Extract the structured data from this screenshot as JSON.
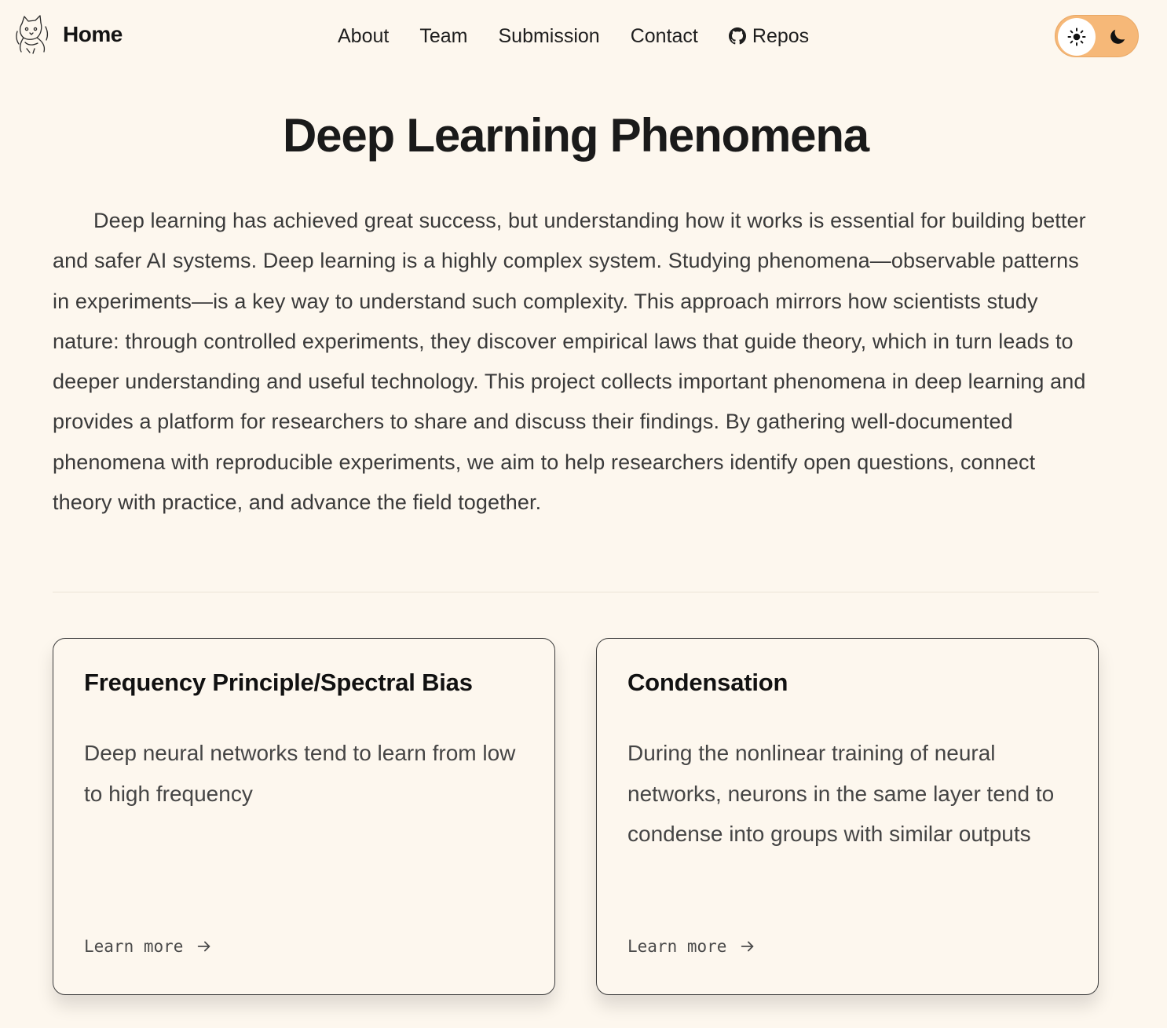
{
  "header": {
    "home_label": "Home",
    "logo_icon": "cat-sketch-logo-icon",
    "nav": [
      {
        "label": "About"
      },
      {
        "label": "Team"
      },
      {
        "label": "Submission"
      },
      {
        "label": "Contact"
      },
      {
        "label": "Repos",
        "icon": "github-icon"
      }
    ],
    "theme_toggle": {
      "light_icon": "sun-icon",
      "dark_icon": "moon-icon",
      "selected": "light",
      "accent_color": "#f6b878"
    }
  },
  "main": {
    "title": "Deep Learning Phenomena",
    "intro": "Deep learning has achieved great success, but understanding how it works is essential for building better and safer AI systems. Deep learning is a highly complex system. Studying phenomena—observable patterns in experiments—is a key way to understand such complexity. This approach mirrors how scientists study nature: through controlled experiments, they discover empirical laws that guide theory, which in turn leads to deeper understanding and useful technology. This project collects important phenomena in deep learning and provides a platform for researchers to share and discuss their findings. By gathering well-documented phenomena with reproducible experiments, we aim to help researchers identify open questions, connect theory with practice, and advance the field together."
  },
  "cards": [
    {
      "title": "Frequency Principle/Spectral Bias",
      "description": "Deep neural networks tend to learn from low to high frequency",
      "link_label": "Learn more"
    },
    {
      "title": "Condensation",
      "description": "During the nonlinear training of neural networks, neurons in the same layer tend to condense into groups with similar outputs",
      "link_label": "Learn more"
    }
  ],
  "colors": {
    "background": "#fdf7ee",
    "text": "#1c1c1c",
    "card_border": "#3d3d3d"
  }
}
